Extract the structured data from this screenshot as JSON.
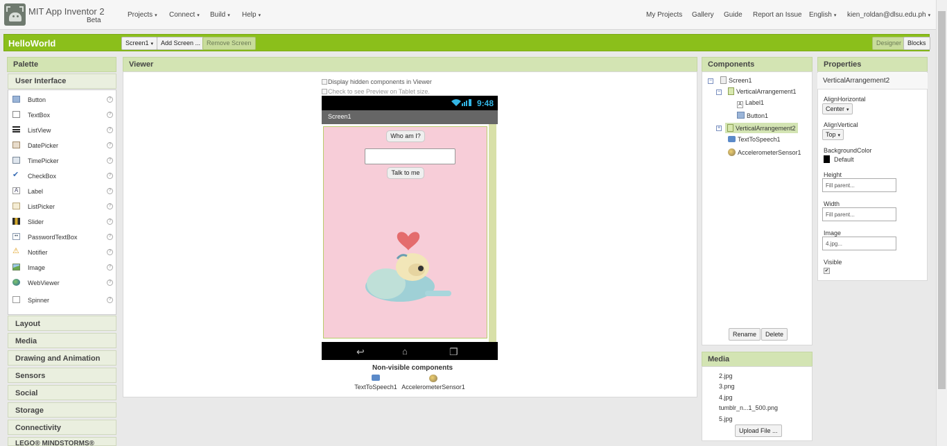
{
  "header": {
    "app_title": "MIT App Inventor 2",
    "beta": "Beta",
    "menus": [
      "Projects",
      "Connect",
      "Build",
      "Help"
    ],
    "right_links": [
      "My Projects",
      "Gallery",
      "Guide",
      "Report an Issue"
    ],
    "language": "English",
    "user": "kien_roldan@dlsu.edu.ph"
  },
  "project_bar": {
    "name": "HelloWorld",
    "screen_select": "Screen1",
    "add_screen": "Add Screen ...",
    "remove_screen": "Remove Screen",
    "designer": "Designer",
    "blocks": "Blocks"
  },
  "palette": {
    "title": "Palette",
    "category_open": "User Interface",
    "items": [
      {
        "label": "Button",
        "icon": "button-icon"
      },
      {
        "label": "TextBox",
        "icon": "textbox-icon"
      },
      {
        "label": "ListView",
        "icon": "listview-icon"
      },
      {
        "label": "DatePicker",
        "icon": "datepicker-icon"
      },
      {
        "label": "TimePicker",
        "icon": "timepicker-icon"
      },
      {
        "label": "CheckBox",
        "icon": "checkbox-icon"
      },
      {
        "label": "Label",
        "icon": "label-icon"
      },
      {
        "label": "ListPicker",
        "icon": "listpicker-icon"
      },
      {
        "label": "Slider",
        "icon": "slider-icon"
      },
      {
        "label": "PasswordTextBox",
        "icon": "password-icon"
      },
      {
        "label": "Notifier",
        "icon": "notifier-icon"
      },
      {
        "label": "Image",
        "icon": "image-icon"
      },
      {
        "label": "WebViewer",
        "icon": "webviewer-icon"
      },
      {
        "label": "Spinner",
        "icon": "spinner-icon"
      }
    ],
    "help_glyph": "?",
    "categories": [
      "Layout",
      "Media",
      "Drawing and Animation",
      "Sensors",
      "Social",
      "Storage",
      "Connectivity",
      "LEGO® MINDSTORMS®"
    ]
  },
  "viewer": {
    "title": "Viewer",
    "hidden_toggle": "Display hidden components in Viewer",
    "tablet_toggle": "Check to see Preview on Tablet size.",
    "clock": "9:48",
    "screen_title": "Screen1",
    "btn_who": "Who am I?",
    "btn_talk": "Talk to me",
    "nonvisible_title": "Non-visible components",
    "nonvisible": [
      "TextToSpeech1",
      "AccelerometerSensor1"
    ]
  },
  "components": {
    "title": "Components",
    "tree": {
      "screen": "Screen1",
      "va1": "VerticalArrangement1",
      "label1": "Label1",
      "button1": "Button1",
      "va2": "VerticalArrangement2",
      "tts": "TextToSpeech1",
      "accel": "AccelerometerSensor1"
    },
    "rename": "Rename",
    "delete": "Delete"
  },
  "media": {
    "title": "Media",
    "files": [
      "2.jpg",
      "3.png",
      "4.jpg",
      "tumblr_n...1_500.png",
      "5.jpg"
    ],
    "upload": "Upload File ..."
  },
  "properties": {
    "title": "Properties",
    "component": "VerticalArrangement2",
    "align_h_label": "AlignHorizontal",
    "align_h_value": "Center",
    "align_v_label": "AlignVertical",
    "align_v_value": "Top",
    "bg_label": "BackgroundColor",
    "bg_value": "Default",
    "height_label": "Height",
    "height_value": "Fill parent...",
    "width_label": "Width",
    "width_value": "Fill parent...",
    "image_label": "Image",
    "image_value": "4.jpg...",
    "visible_label": "Visible"
  },
  "colors": {
    "brand_green": "#8bbf1b",
    "panel_header": "#d3e4b3",
    "phone_bg": "#f7cdd8",
    "clock_blue": "#33b5e5"
  }
}
